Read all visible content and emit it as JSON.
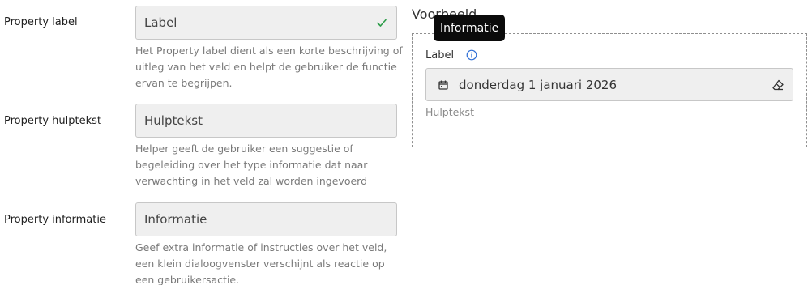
{
  "form": {
    "label": {
      "title": "Property label",
      "value": "Label",
      "help": "Het Property label dient als een korte beschrijving of uitleg van het veld en helpt de gebruiker de functie ervan te begrijpen."
    },
    "helptext": {
      "title": "Property hulptekst",
      "value": "Hulptekst",
      "help": "Helper geeft de gebruiker een suggestie of begeleiding over het type informatie dat naar verwachting in het veld zal worden ingevoerd"
    },
    "information": {
      "title": "Property informatie",
      "value": "Informatie",
      "help": "Geef extra informatie of instructies over het veld, een klein dialoogvenster verschijnt als reactie op een gebruikersactie."
    }
  },
  "preview": {
    "title": "Voorbeeld",
    "field_label": "Label",
    "date_value": "donderdag 1 januari 2026",
    "help": "Hulptekst",
    "tooltip": "Informatie"
  },
  "colors": {
    "success_check": "#2e9d4a",
    "info_icon": "#2f6fd6",
    "tooltip_bg": "#0b0b0b"
  },
  "icons": {
    "check": "check-icon",
    "info": "info-icon",
    "calendar": "calendar-icon",
    "eraser": "eraser-icon"
  }
}
